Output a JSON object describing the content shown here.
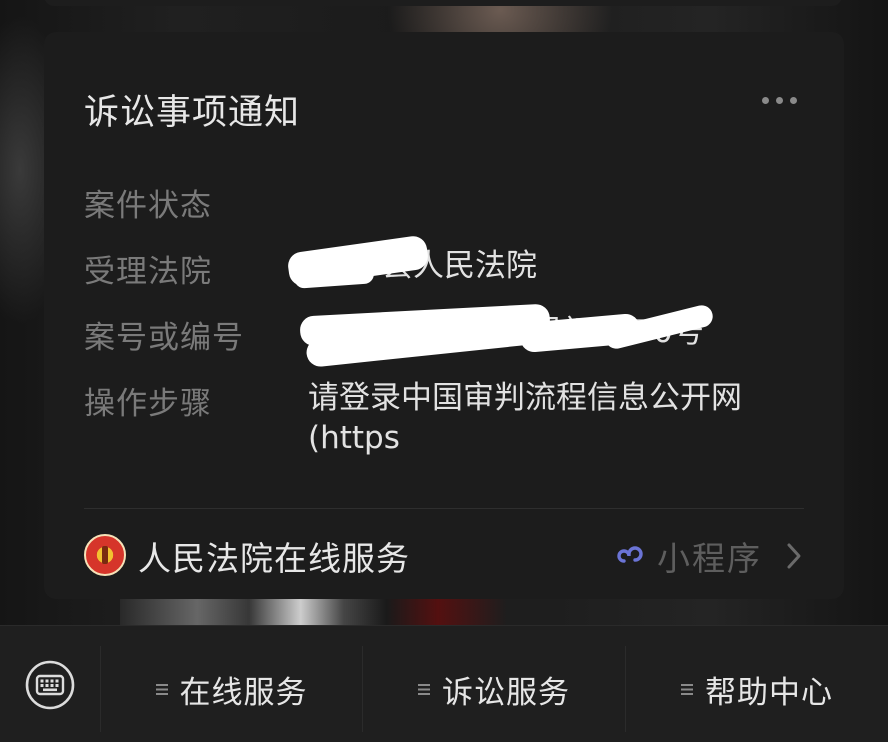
{
  "card": {
    "title": "诉讼事项通知",
    "rows": [
      {
        "label": "案件状态",
        "value": ""
      },
      {
        "label": "受理法院",
        "value": "县人民法院"
      },
      {
        "label": "案号或编号",
        "value": "民初3270号"
      },
      {
        "label": "操作步骤",
        "value": "请登录中国审判流程信息公开网(https"
      }
    ],
    "service_name": "人民法院在线服务",
    "mini_program_label": "小程序"
  },
  "menu": {
    "items": [
      {
        "label": "在线服务"
      },
      {
        "label": "诉讼服务"
      },
      {
        "label": "帮助中心"
      }
    ]
  },
  "icons": {
    "more": "more-dots-icon",
    "mini_program": "mini-program-link-icon",
    "chevron": "chevron-right-icon",
    "keyboard": "keyboard-icon",
    "menu": "hamburger-icon",
    "logo": "court-emblem-icon"
  },
  "colors": {
    "card_bg": "#1c1c1c",
    "title": "#e7e7e7",
    "label": "#7a7a7a",
    "accent": "#6b74d6"
  }
}
